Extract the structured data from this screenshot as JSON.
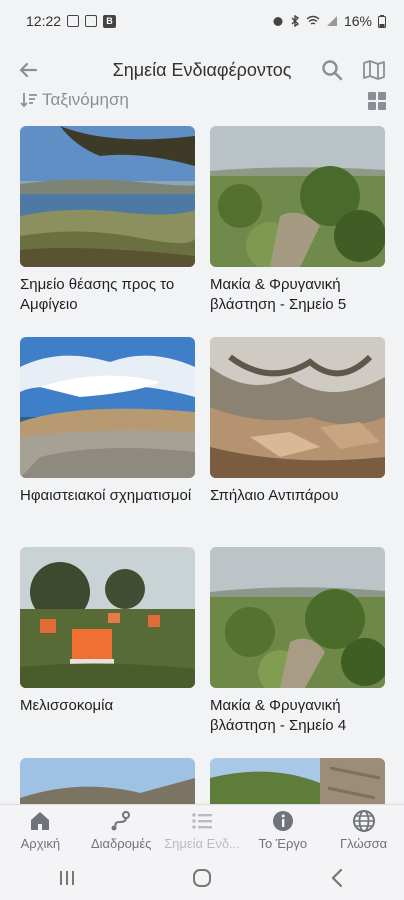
{
  "status": {
    "time": "12:22",
    "battery": "16%"
  },
  "appbar": {
    "title": "Σημεία Ενδιαφέροντος",
    "back_icon": "back-arrow-icon",
    "search_icon": "search-icon",
    "map_icon": "map-icon"
  },
  "sort": {
    "label": "Ταξινόμηση",
    "icon": "sort-icon",
    "view_icon": "grid-view-icon"
  },
  "cards": [
    {
      "title": "Σημείο θέασης προς το Αμφίγειο",
      "image": "coastal-view"
    },
    {
      "title": "Μακία & Φρυγανική βλάστηση - Σημείο 5",
      "image": "shrubland"
    },
    {
      "title": "Ηφαιστειακοί σχηματισμοί",
      "image": "volcanic-coast"
    },
    {
      "title": "Σπήλαιο Αντιπάρου",
      "image": "cave"
    },
    {
      "title": "Μελισσοκομία",
      "image": "beehives"
    },
    {
      "title": "Μακία & Φρυγανική βλάστηση - Σημείο 4",
      "image": "shrubland"
    },
    {
      "title": "",
      "image": "hill"
    },
    {
      "title": "",
      "image": "hill-rock"
    }
  ],
  "bottom_nav": [
    {
      "label": "Αρχική",
      "icon": "home-icon",
      "active": false
    },
    {
      "label": "Διαδρομές",
      "icon": "routes-icon",
      "active": false
    },
    {
      "label": "Σημεία Ενδ...",
      "icon": "list-icon",
      "active": true
    },
    {
      "label": "Το Έργο",
      "icon": "info-icon",
      "active": false
    },
    {
      "label": "Γλώσσα",
      "icon": "globe-icon",
      "active": false
    }
  ],
  "colors": {
    "background": "#f2f3f5",
    "icon_gray": "#8a8f96",
    "nav_inactive": "#6f747b",
    "nav_active": "#b7bcc2"
  }
}
